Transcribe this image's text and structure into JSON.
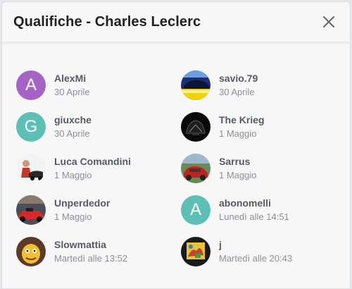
{
  "dialog": {
    "title": "Qualifiche - Charles Leclerc",
    "close_icon": "close-icon"
  },
  "colors": {
    "purple_avatar": "#a663c6",
    "teal_avatar": "#5dbfb5"
  },
  "people": [
    {
      "name": "AlexMi",
      "date": "30 Aprile",
      "avatar": {
        "type": "letter",
        "letter": "A",
        "color": "#a663c6"
      }
    },
    {
      "name": "savio.79",
      "date": "30 Aprile",
      "avatar": {
        "type": "photo",
        "icon": "car-photo-blue-yellow"
      }
    },
    {
      "name": "giuxche",
      "date": "30 Aprile",
      "avatar": {
        "type": "letter",
        "letter": "G",
        "color": "#5dbfb5"
      }
    },
    {
      "name": "The Krieg",
      "date": "1 Maggio",
      "avatar": {
        "type": "photo",
        "icon": "dark-car-photo"
      }
    },
    {
      "name": "Luca Comandini",
      "date": "1 Maggio",
      "avatar": {
        "type": "photo",
        "icon": "person-with-car-photo"
      }
    },
    {
      "name": "Sarrus",
      "date": "1 Maggio",
      "avatar": {
        "type": "photo",
        "icon": "red-car-photo"
      }
    },
    {
      "name": "Unperdedor",
      "date": "1 Maggio",
      "avatar": {
        "type": "photo",
        "icon": "red-racecar-photo"
      }
    },
    {
      "name": "abonomelli",
      "date": "Lunedì alle 14:51",
      "avatar": {
        "type": "letter",
        "letter": "A",
        "color": "#5dbfb5"
      }
    },
    {
      "name": "Slowmattia",
      "date": "Martedì alle 13:52",
      "avatar": {
        "type": "photo",
        "icon": "cartoon-character-photo"
      }
    },
    {
      "name": "j",
      "date": "Martedì alle 20:43",
      "avatar": {
        "type": "photo",
        "icon": "painting-photo"
      }
    }
  ]
}
